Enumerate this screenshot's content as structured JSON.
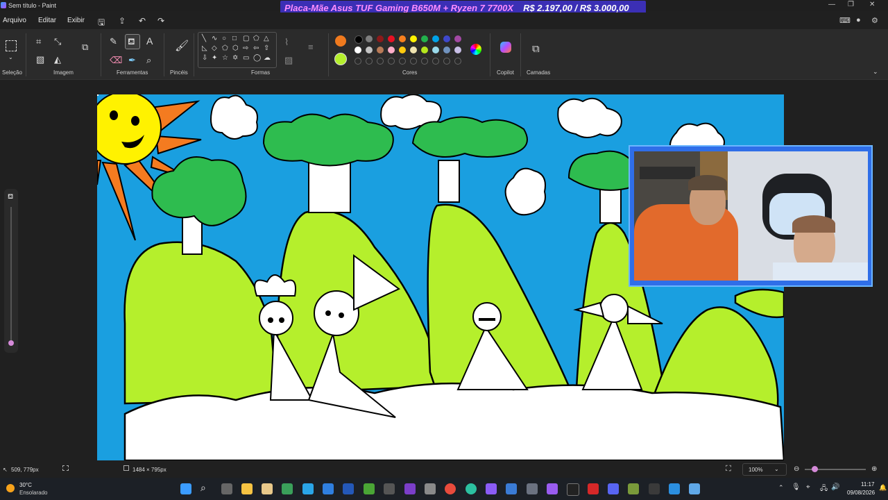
{
  "window": {
    "title": "Sem título - Paint",
    "ad_banner": {
      "left": "Placa-Mãe Asus TUF Gaming B650M + Ryzen 7 7700X",
      "right": "R$ 2.197,00 / R$ 3.000,00"
    }
  },
  "menu": {
    "items": [
      "Arquivo",
      "Editar",
      "Exibir"
    ]
  },
  "ribbon": {
    "groups": {
      "selection": "Seleção",
      "image": "Imagem",
      "tools": "Ferramentas",
      "brushes": "Pincéis",
      "shapes": "Formas",
      "colors": "Cores",
      "copilot": "Copilot",
      "layers": "Camadas"
    },
    "primary_color": "#f07a1e",
    "secondary_color": "#b4ef2c",
    "palette": [
      "#000000",
      "#7f7f7f",
      "#8b1a1a",
      "#e81123",
      "#f7801e",
      "#fff200",
      "#22b14c",
      "#00a2e8",
      "#3f48cc",
      "#a349a4",
      "#ffffff",
      "#c3c3c3",
      "#b97a57",
      "#ffaec9",
      "#ffc90e",
      "#efe4b0",
      "#b5e61d",
      "#99d9ea",
      "#7092be",
      "#c8bfe7"
    ]
  },
  "status": {
    "cursor": "509, 779px",
    "canvas_size": "1484 × 795px",
    "zoom": "100%"
  },
  "taskbar": {
    "weather_temp": "30°C",
    "weather_desc": "Ensolarado",
    "time": "11:17",
    "date": "09/08/2026"
  }
}
